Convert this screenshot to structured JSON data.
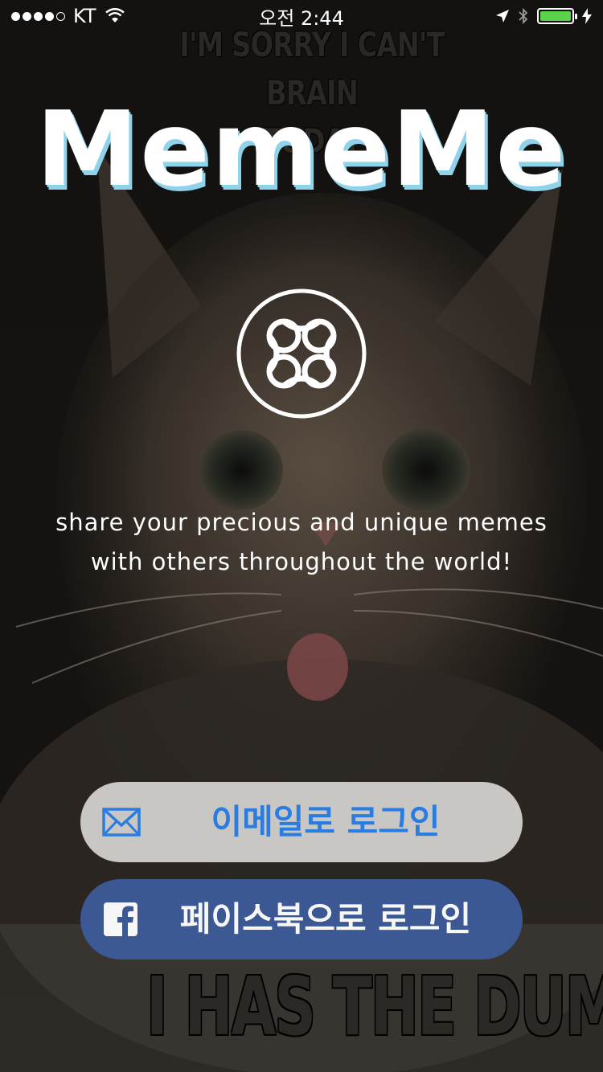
{
  "status_bar": {
    "carrier": "KT",
    "time": "오전 2:44"
  },
  "meme": {
    "top_line1": "I'M SORRY I CAN'T BRAIN",
    "top_line2": "TODAY",
    "bottom": "I HAS THE DUMI"
  },
  "app": {
    "title": "MemeMe",
    "tagline_line1": "share your precious and unique memes",
    "tagline_line2": "with others throughout the world!"
  },
  "buttons": {
    "email_login": "이메일로 로그인",
    "facebook_login": "페이스북으로 로그인"
  },
  "icons": {
    "logo": "clover-knot-logo",
    "email": "envelope-icon",
    "facebook": "facebook-icon"
  },
  "colors": {
    "title_shadow": "#8fd3ea",
    "email_text": "#2a7de0",
    "email_button_bg": "#d7d5d2",
    "facebook_button_bg": "#3d5b99",
    "battery": "#5ad34a"
  }
}
